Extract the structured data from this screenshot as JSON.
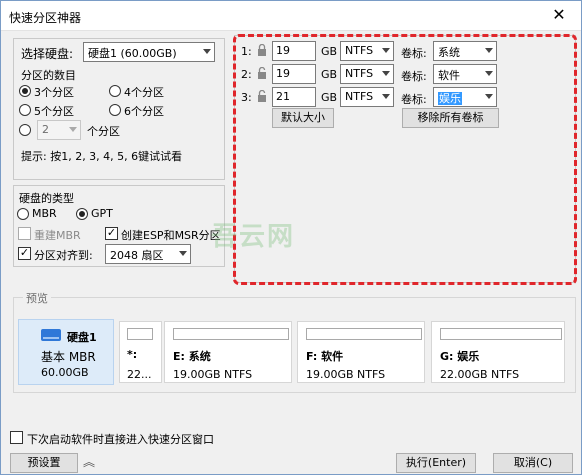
{
  "window": {
    "title": "快速分区神器",
    "close": "✕"
  },
  "disk_select": {
    "label": "选择硬盘:",
    "value": "硬盘1 (60.00GB)"
  },
  "partition_count": {
    "label": "分区的数目",
    "options": [
      "3个分区",
      "4个分区",
      "5个分区",
      "6个分区"
    ],
    "selected": "3个分区",
    "custom_value": "2",
    "custom_suffix": "个分区",
    "hint": "提示: 按1, 2, 3, 4, 5, 6键试试看"
  },
  "disk_type": {
    "label": "硬盘的类型",
    "options": [
      "MBR",
      "GPT"
    ],
    "selected": "GPT",
    "rebuild_mbr": "重建MBR",
    "create_esp": "创建ESP和MSR分区",
    "align_label": "分区对齐到:",
    "align_value": "2048 扇区"
  },
  "partitions": [
    {
      "index": "1:",
      "size": "19",
      "unit": "GB",
      "fs": "NTFS",
      "vol_label": "卷标:",
      "vol_value": "系统"
    },
    {
      "index": "2:",
      "size": "19",
      "unit": "GB",
      "fs": "NTFS",
      "vol_label": "卷标:",
      "vol_value": "软件"
    },
    {
      "index": "3:",
      "size": "21",
      "unit": "GB",
      "fs": "NTFS",
      "vol_label": "卷标:",
      "vol_value": "娱乐"
    }
  ],
  "buttons": {
    "default_size": "默认大小",
    "remove_labels": "移除所有卷标",
    "preset": "预设置",
    "execute": "执行(Enter)",
    "cancel": "取消(C)"
  },
  "preview": {
    "label": "预览",
    "disk": {
      "name": "硬盘1",
      "type": "基本 MBR",
      "size": "60.00GB"
    },
    "cards": [
      {
        "title": "*:",
        "sub": "22..."
      },
      {
        "title": "E: 系统",
        "sub": "19.00GB NTFS"
      },
      {
        "title": "F: 软件",
        "sub": "19.00GB NTFS"
      },
      {
        "title": "G: 娱乐",
        "sub": "22.00GB NTFS"
      }
    ]
  },
  "footer": {
    "checkbox_label": "下次启动软件时直接进入快速分区窗口"
  },
  "watermark": "吾云网",
  "colors": {
    "accent_red": "#e0262b",
    "disk_icon": "#2f78d8"
  }
}
